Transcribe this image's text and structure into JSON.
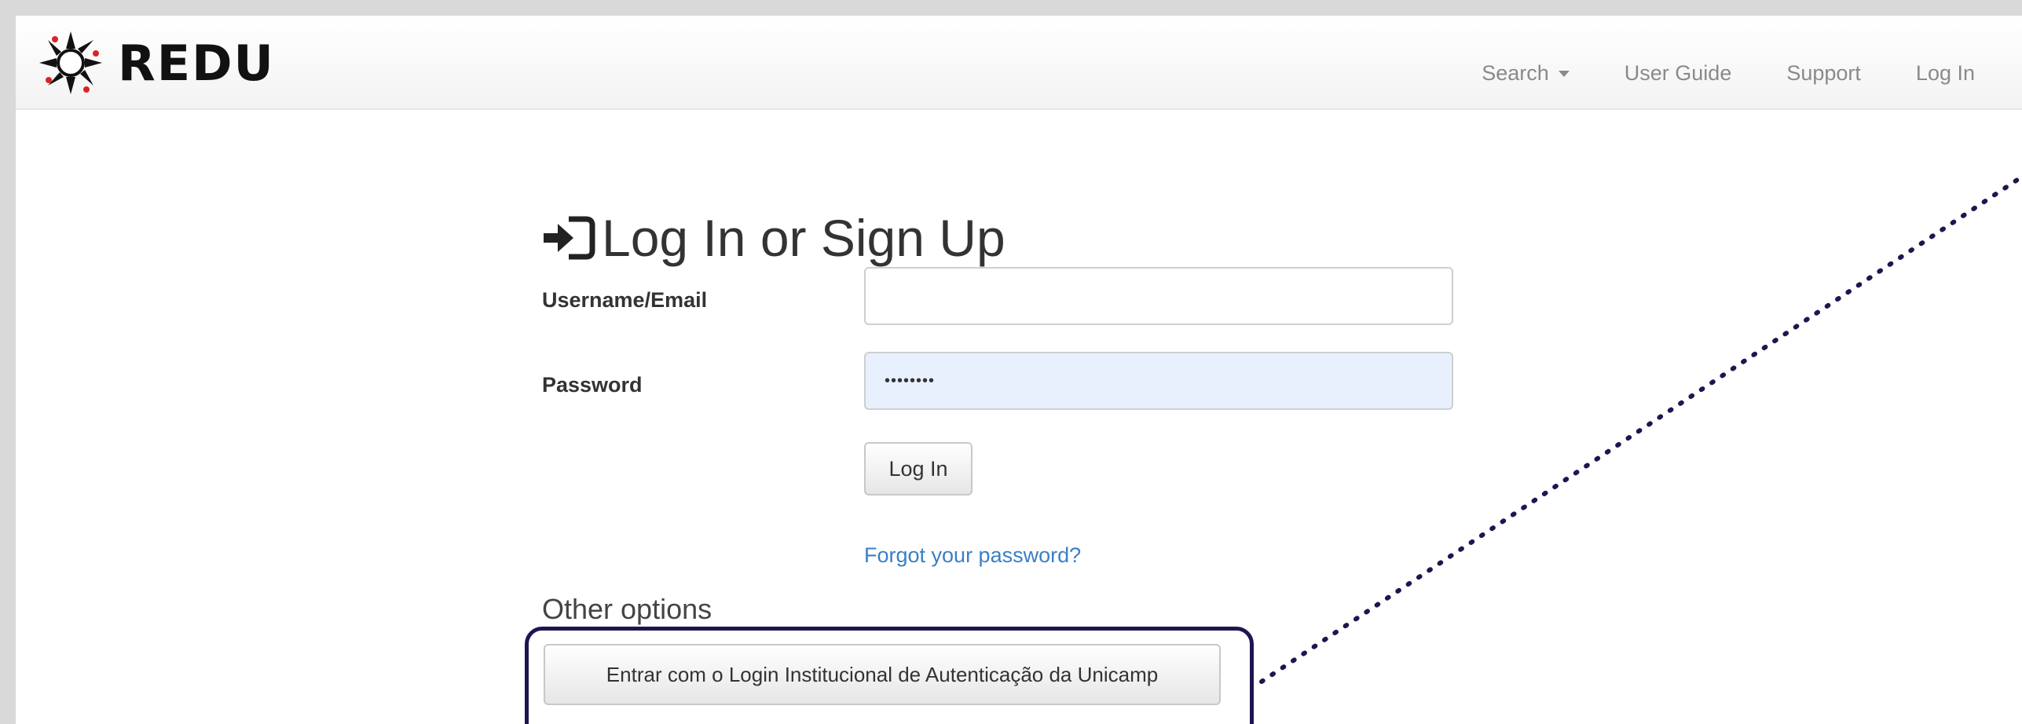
{
  "brand": {
    "name": "REDU",
    "logo_icon": "unicamp-logo-icon"
  },
  "nav": {
    "search": "Search",
    "user_guide": "User Guide",
    "support": "Support",
    "login": "Log In"
  },
  "form": {
    "title": "Log In or Sign Up",
    "title_icon": "sign-in-icon",
    "username_label": "Username/Email",
    "username_value": "",
    "password_label": "Password",
    "password_value": "••••••••",
    "login_button": "Log In",
    "forgot_link": "Forgot your password?",
    "other_options": "Other options",
    "unicamp_button": "Entrar com o Login Institucional de Autenticação da Unicamp"
  },
  "colors": {
    "link": "#3a7fc4",
    "highlight_border": "#1d1650",
    "password_bg": "#e8f0fe"
  }
}
